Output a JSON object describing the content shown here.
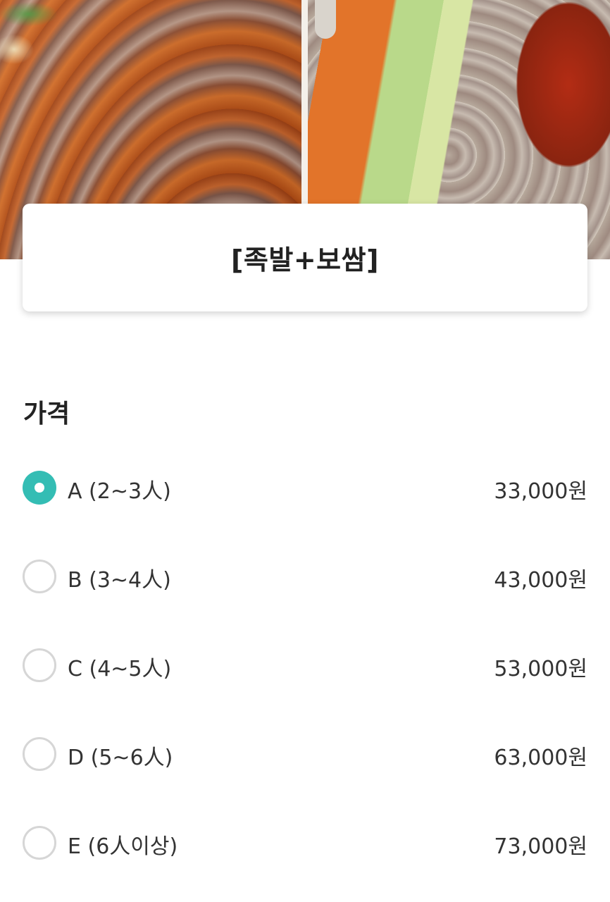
{
  "product": {
    "title": "[족발+보쌈]"
  },
  "price_section": {
    "heading": "가격",
    "options": [
      {
        "label": "A (2~3人)",
        "price": "33,000원",
        "selected": true
      },
      {
        "label": "B (3~4人)",
        "price": "43,000원",
        "selected": false
      },
      {
        "label": "C (4~5人)",
        "price": "53,000원",
        "selected": false
      },
      {
        "label": "D (5~6人)",
        "price": "63,000원",
        "selected": false
      },
      {
        "label": "E (6人이상)",
        "price": "73,000원",
        "selected": false
      }
    ]
  },
  "colors": {
    "accent": "#34bdb4",
    "radio_border": "#d6d6d6",
    "text": "#222222"
  }
}
